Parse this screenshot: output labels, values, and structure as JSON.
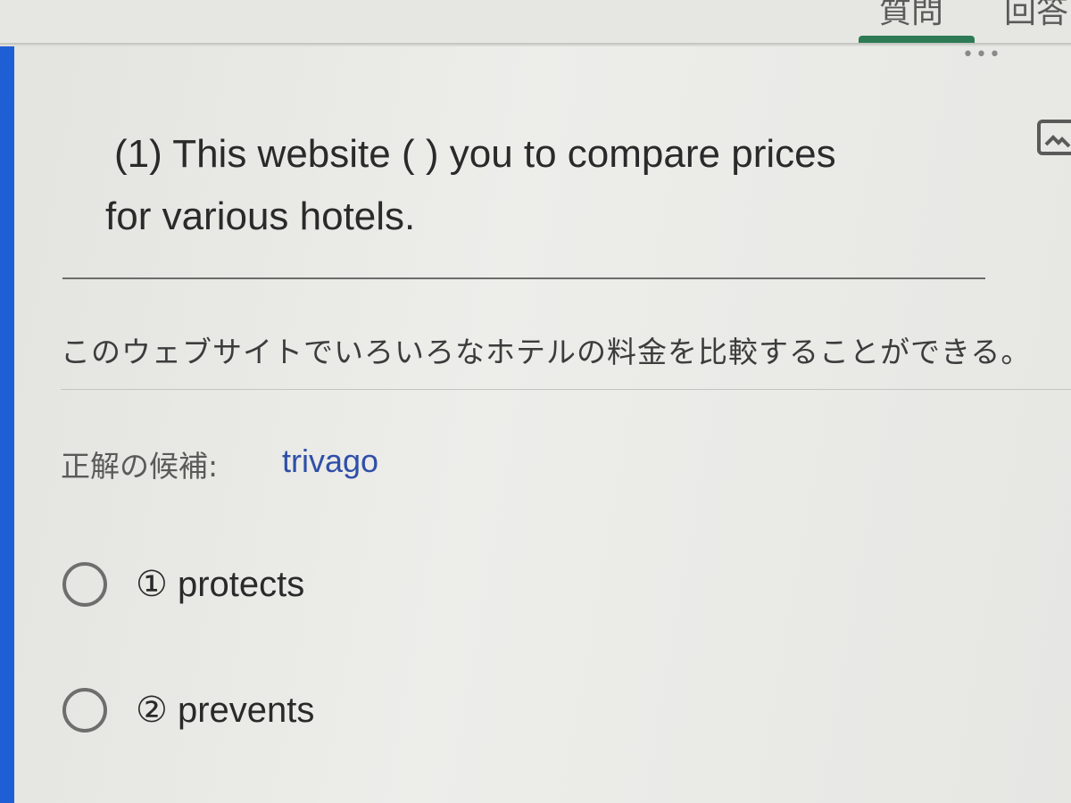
{
  "tabs": [
    {
      "label": "質問"
    },
    {
      "label": "回答"
    }
  ],
  "question": {
    "line1": "(1) This website (      ) you to compare prices",
    "line2": "for various hotels."
  },
  "description": "このウェブサイトでいろいろなホテルの料金を比較することができる。",
  "candidates": {
    "label": "正解の候補:",
    "value": "trivago"
  },
  "options": [
    {
      "label": "① protects"
    },
    {
      "label": "② prevents"
    }
  ],
  "colors": {
    "accent": "#1f5fd6",
    "tab_indicator": "#2e7a55",
    "candidate_value": "#2f4fa8"
  },
  "icons": {
    "more": "more-dots-icon",
    "image": "image-icon"
  }
}
